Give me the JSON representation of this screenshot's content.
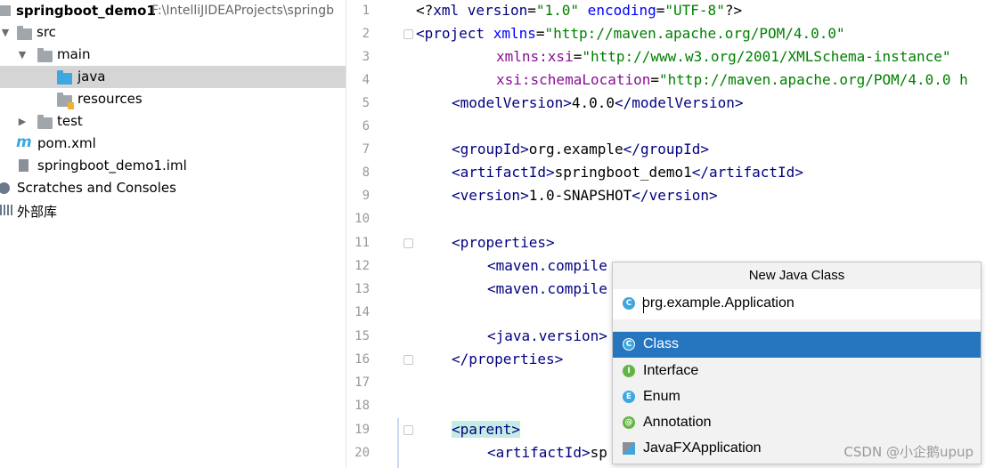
{
  "project_tree": {
    "root": {
      "name": "springboot_demo1",
      "path": "F:\\IntelliJIDEAProjects\\springb"
    },
    "items": [
      {
        "label": "src"
      },
      {
        "label": "main"
      },
      {
        "label": "java"
      },
      {
        "label": "resources"
      },
      {
        "label": "test"
      },
      {
        "label": "pom.xml"
      },
      {
        "label": "springboot_demo1.iml"
      },
      {
        "label": "Scratches and Consoles"
      },
      {
        "label": "外部库"
      }
    ]
  },
  "editor": {
    "line_numbers": [
      "1",
      "2",
      "3",
      "4",
      "5",
      "6",
      "7",
      "8",
      "9",
      "10",
      "11",
      "12",
      "13",
      "14",
      "15",
      "16",
      "17",
      "18",
      "19",
      "20"
    ],
    "lines": {
      "l1": {
        "a": "<?",
        "b": "xml version",
        "c": "=",
        "d": "\"1.0\"",
        "e": " encoding",
        "f": "=",
        "g": "\"UTF-8\"",
        "h": "?>"
      },
      "l2": {
        "a": "<project ",
        "b": "xmlns",
        "c": "=",
        "d": "\"http://maven.apache.org/POM/4.0.0\""
      },
      "l3": {
        "a": "xmlns:xsi",
        "b": "=",
        "c": "\"http://www.w3.org/2001/XMLSchema-instance\""
      },
      "l4": {
        "a": "xsi:schemaLocation",
        "b": "=",
        "c": "\"http://maven.apache.org/POM/4.0.0 h"
      },
      "l5": {
        "a": "<modelVersion>",
        "b": "4.0.0",
        "c": "</modelVersion>"
      },
      "l7": {
        "a": "<groupId>",
        "b": "org.example",
        "c": "</groupId>"
      },
      "l8": {
        "a": "<artifactId>",
        "b": "springboot_demo1",
        "c": "</artifactId>"
      },
      "l9": {
        "a": "<version>",
        "b": "1.0-SNAPSHOT",
        "c": "</version>"
      },
      "l11": {
        "a": "<properties>"
      },
      "l12": {
        "a": "<maven.compile"
      },
      "l13": {
        "a": "<maven.compile"
      },
      "l15": {
        "a": "<java.version>"
      },
      "l16": {
        "a": "</properties>"
      },
      "l19": {
        "a": "<parent>"
      },
      "l20": {
        "a": "<artifactId>",
        "b": "sp"
      }
    }
  },
  "popup": {
    "title": "New Java Class",
    "input_value": "org.example.Application",
    "options": [
      {
        "label": "Class",
        "icon": "C",
        "icon_color": "#3ea7df",
        "selected": true
      },
      {
        "label": "Interface",
        "icon": "I",
        "icon_color": "#62b543",
        "selected": false
      },
      {
        "label": "Enum",
        "icon": "E",
        "icon_color": "#3ea7df",
        "selected": false
      },
      {
        "label": "Annotation",
        "icon": "@",
        "icon_color": "#62b543",
        "selected": false
      },
      {
        "label": "JavaFXApplication",
        "icon": "javafx-icon",
        "selected": false
      }
    ]
  },
  "watermark": "CSDN @小企鹅upup",
  "colors": {
    "selection": "#2675bf",
    "tag": "#000080",
    "attr": "#0000ff",
    "string": "#008000"
  }
}
